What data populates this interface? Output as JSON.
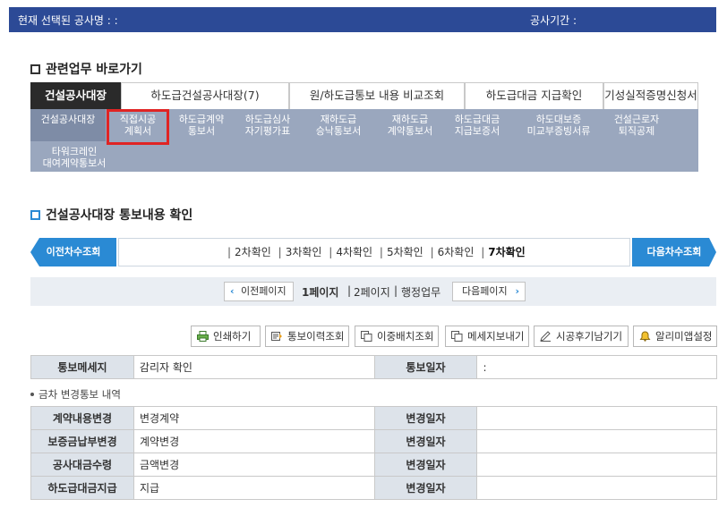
{
  "header": {
    "current_project_label": "현재 선택된 공사명 : :",
    "period_label": "공사기간 :"
  },
  "section1": {
    "title": "관련업무 바로가기"
  },
  "tabs": [
    {
      "label": "건설공사대장",
      "active": true
    },
    {
      "label": "하도급건설공사대장(7)",
      "active": false
    },
    {
      "label": "원/하도급통보 내용 비교조회",
      "active": false
    },
    {
      "label": "하도급대금 지급확인",
      "active": false
    },
    {
      "label": "기성실적증명신청서",
      "active": false
    }
  ],
  "subnav": [
    {
      "line1": "건설공사대장",
      "line2": ""
    },
    {
      "line1": "직접시공",
      "line2": "계획서"
    },
    {
      "line1": "하도급계약",
      "line2": "통보서"
    },
    {
      "line1": "하도급심사",
      "line2": "자기평가표"
    },
    {
      "line1": "재하도급",
      "line2": "승낙통보서"
    },
    {
      "line1": "재하도급",
      "line2": "계약통보서"
    },
    {
      "line1": "하도급대금",
      "line2": "지급보증서"
    },
    {
      "line1": "하도대보증",
      "line2": "미교부증빙서류"
    },
    {
      "line1": "건설근로자",
      "line2": "퇴직공제"
    },
    {
      "line1": "타워크레인",
      "line2": "대여계약통보서"
    }
  ],
  "section2": {
    "title": "건설공사대장 통보내용 확인"
  },
  "chasu": {
    "prev_label": "이전차수조회",
    "next_label": "다음차수조회",
    "items": [
      "2차확인",
      "3차확인",
      "4차확인",
      "5차확인",
      "6차확인"
    ],
    "current": "7차확인"
  },
  "paging": {
    "prev_label": "이전페이지",
    "page1": "1페이지",
    "page2": "2페이지",
    "admin": "행정업무",
    "next_label": "다음페이지"
  },
  "toolbar": [
    {
      "label": "인쇄하기",
      "icon": "printer-icon"
    },
    {
      "label": "통보이력조회",
      "icon": "history-icon"
    },
    {
      "label": "이중배치조회",
      "icon": "duplicate-icon"
    },
    {
      "label": "메세지보내기",
      "icon": "message-icon"
    },
    {
      "label": "시공후기남기기",
      "icon": "pencil-icon"
    },
    {
      "label": "알리미앱설정",
      "icon": "bell-icon"
    }
  ],
  "notice_table": {
    "label1": "통보메세지",
    "value1": "감리자 확인",
    "label2": "통보일자",
    "value2": ":"
  },
  "change_section": {
    "bullet": "금차 변경통보 내역"
  },
  "change_table": {
    "date_label": "변경일자",
    "rows": [
      {
        "label": "계약내용변경",
        "value": "변경계약",
        "date": ""
      },
      {
        "label": "보증금납부변경",
        "value": "계약변경",
        "date": ""
      },
      {
        "label": "공사대금수령",
        "value": "금액변경",
        "date": ""
      },
      {
        "label": "하도급대금지급",
        "value": "지급",
        "date": ""
      }
    ]
  },
  "colors": {
    "header_bg": "#2c4a96",
    "accent_blue": "#2a8ad4",
    "subnav_bg": "#9aa7be",
    "highlight_red": "#e02424"
  }
}
